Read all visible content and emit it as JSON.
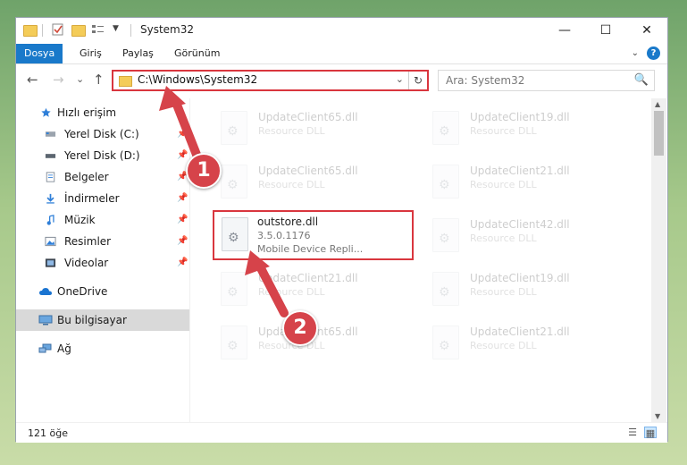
{
  "window": {
    "title": "System32",
    "controls": {
      "minimize": "—",
      "maximize": "☐",
      "close": "✕"
    }
  },
  "ribbon": {
    "tabs": [
      "Dosya",
      "Giriş",
      "Paylaş",
      "Görünüm"
    ],
    "expand_icon": "chevron-down-icon",
    "help_label": "?"
  },
  "nav": {
    "back": "←",
    "forward": "→",
    "recent": "⌄",
    "up": "↑",
    "address": "C:\\Windows\\System32",
    "address_dropdown": "⌄",
    "refresh": "↻",
    "search_placeholder": "Ara: System32",
    "search_icon": "🔍"
  },
  "sidebar": {
    "items": [
      {
        "label": "Hızlı erişim",
        "icon": "star-icon",
        "pinned": false
      },
      {
        "label": "Yerel Disk (C:)",
        "icon": "drive-icon",
        "pinned": true
      },
      {
        "label": "Yerel Disk (D:)",
        "icon": "drive-icon",
        "pinned": true
      },
      {
        "label": "Belgeler",
        "icon": "document-icon",
        "pinned": true
      },
      {
        "label": "İndirmeler",
        "icon": "download-icon",
        "pinned": true
      },
      {
        "label": "Müzik",
        "icon": "music-icon",
        "pinned": true
      },
      {
        "label": "Resimler",
        "icon": "pictures-icon",
        "pinned": true
      },
      {
        "label": "Videolar",
        "icon": "video-icon",
        "pinned": true
      },
      {
        "label": "OneDrive",
        "icon": "cloud-icon",
        "pinned": false
      },
      {
        "label": "Bu bilgisayar",
        "icon": "computer-icon",
        "pinned": false,
        "selected": true
      },
      {
        "label": "Ağ",
        "icon": "network-icon",
        "pinned": false
      }
    ],
    "pin_glyph": "📌"
  },
  "files": [
    {
      "name": "UpdateClient65.dll",
      "desc": "Resource DLL",
      "faded": true
    },
    {
      "name": "UpdateClient19.dll",
      "desc": "Resource DLL",
      "faded": true
    },
    {
      "name": "UpdateClient65.dll",
      "desc": "Resource DLL",
      "faded": true
    },
    {
      "name": "UpdateClient21.dll",
      "desc": "Resource DLL",
      "faded": true
    },
    {
      "name": "outstore.dll",
      "version": "3.5.0.1176",
      "desc": "Mobile Device Repli...",
      "faded": false,
      "highlighted": true
    },
    {
      "name": "UpdateClient42.dll",
      "desc": "Resource DLL",
      "faded": true
    },
    {
      "name": "UpdateClient21.dll",
      "desc": "Resource DLL",
      "faded": true
    },
    {
      "name": "UpdateClient19.dll",
      "desc": "Resource DLL",
      "faded": true
    },
    {
      "name": "UpdateClient65.dll",
      "desc": "Resource DLL",
      "faded": true
    },
    {
      "name": "UpdateClient21.dll",
      "desc": "Resource DLL",
      "faded": true
    }
  ],
  "status": {
    "count": "121 öğe"
  },
  "annotations": {
    "badge1": "1",
    "badge2": "2",
    "color": "#d6434a"
  }
}
